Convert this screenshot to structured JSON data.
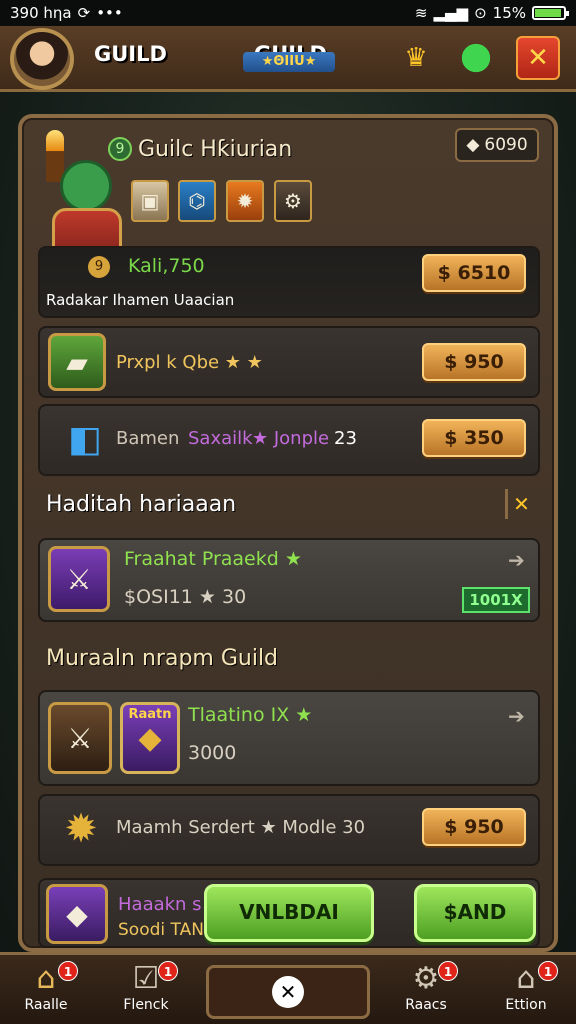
{
  "status_bar": {
    "time": "390 hƞa",
    "battery": "15%"
  },
  "header": {
    "title_left": "GUILD",
    "title_right": "GUILD",
    "badge": "★ΘΙΙU★"
  },
  "guild_card": {
    "name": "Guilc Hƙiurian",
    "coins": "6090",
    "kali": "Kali,750",
    "subtitle": "Radakar Ihamen Uaacian",
    "price": "$ 6510"
  },
  "rows": [
    {
      "label": "Prxpl k Qbe ★ ★",
      "price": "$ 950"
    },
    {
      "label_a": "Bamen",
      "label_b": "Saxailk",
      "label_c": "★ Jonple",
      "label_d": "23",
      "price": "$ 350"
    }
  ],
  "section1": {
    "title": "Haditah hariaaan",
    "close": "✕"
  },
  "offer1": {
    "title": "Fraahat Praaekd ★",
    "value": "$OSI11 ★ 30",
    "tag": "1001X"
  },
  "section2": {
    "title": "Muraaln nrapm Guild"
  },
  "offer2": {
    "title": "Tlaatino IX ★",
    "value": "3000",
    "badge": "Raatn"
  },
  "row3": {
    "label": "Maamh Serdert ★ Modle 30",
    "price": "$ 950"
  },
  "bottom_card": {
    "line1": "Haaakn s",
    "line2": "Soodi TAN"
  },
  "buttons": {
    "green_left": "VNLBDAI",
    "green_right": "$AND"
  },
  "bottom_nav": [
    {
      "label": "Raalle",
      "badge": "1"
    },
    {
      "label": "Flenck",
      "badge": "1"
    },
    {
      "label": "",
      "badge": ""
    },
    {
      "label": "Raacs",
      "badge": "1"
    },
    {
      "label": "Ettion",
      "badge": "1"
    }
  ],
  "colors": {
    "accent_gold": "#f0b359",
    "accent_green": "#8fe14f",
    "text_green": "#7bd84a",
    "text_purple": "#c36bdc"
  }
}
